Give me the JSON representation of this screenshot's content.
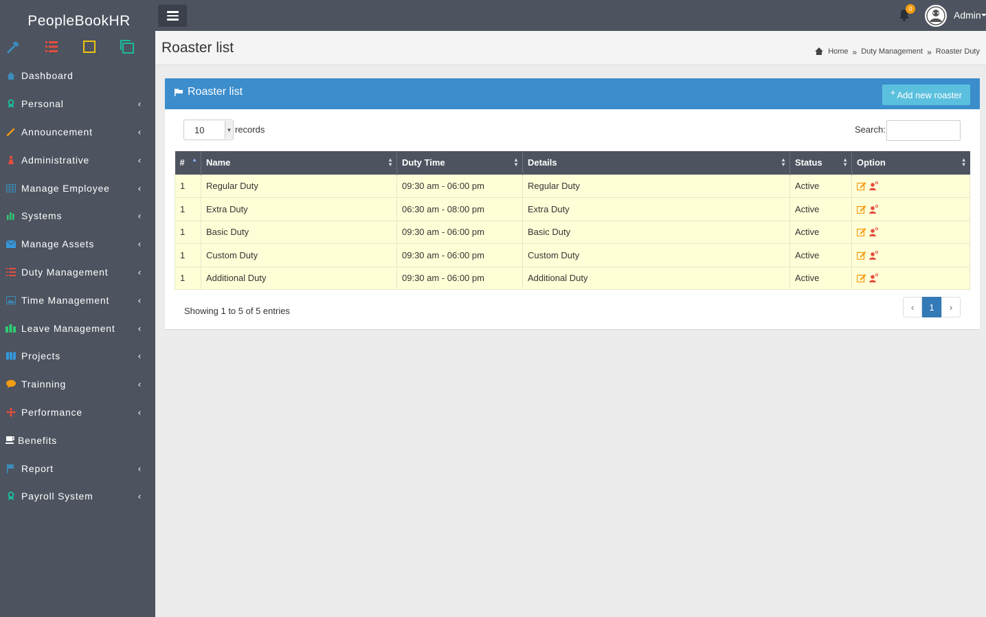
{
  "app": {
    "brand": "PeopleBookHR"
  },
  "sidebar": {
    "items": [
      {
        "label": "Dashboard",
        "icon": "home-icon",
        "color": "#3c8dbc",
        "has_children": false
      },
      {
        "label": "Personal",
        "icon": "award-icon",
        "color": "#1abc9c",
        "has_children": true
      },
      {
        "label": "Announcement",
        "icon": "pencil-icon",
        "color": "#f39c12",
        "has_children": true
      },
      {
        "label": "Administrative",
        "icon": "user-icon",
        "color": "#e74c3c",
        "has_children": true
      },
      {
        "label": "Manage Employee",
        "icon": "table-icon",
        "color": "#3c8dbc",
        "has_children": true
      },
      {
        "label": "Systems",
        "icon": "bar-chart-icon",
        "color": "#2ecc71",
        "has_children": true
      },
      {
        "label": "Manage Assets",
        "icon": "envelope-icon",
        "color": "#3498db",
        "has_children": true
      },
      {
        "label": "Duty Management",
        "icon": "list-icon",
        "color": "#e74c3c",
        "has_children": true
      },
      {
        "label": "Time Management",
        "icon": "picture-icon",
        "color": "#3c8dbc",
        "has_children": true
      },
      {
        "label": "Leave Management",
        "icon": "users-icon",
        "color": "#2ecc71",
        "has_children": true
      },
      {
        "label": "Projects",
        "icon": "map-icon",
        "color": "#3498db",
        "has_children": true
      },
      {
        "label": "Trainning",
        "icon": "comment-icon",
        "color": "#f39c12",
        "has_children": true
      },
      {
        "label": "Performance",
        "icon": "arrows-icon",
        "color": "#e74c3c",
        "has_children": true
      },
      {
        "label": "Benefits",
        "icon": "coffee-icon",
        "color": "#ffffff",
        "has_children": false
      },
      {
        "label": "Report",
        "icon": "flag-icon",
        "color": "#3c8dbc",
        "has_children": true
      },
      {
        "label": "Payroll System",
        "icon": "award-icon",
        "color": "#1abc9c",
        "has_children": true
      }
    ]
  },
  "topbar": {
    "notification_count": "0",
    "user_name": "Admin"
  },
  "header": {
    "title": "Roaster list",
    "breadcrumb": [
      "Home",
      "Duty Management",
      "Roaster Duty"
    ]
  },
  "panel": {
    "title": "Roaster list",
    "add_button": "Add new roaster",
    "page_length": "10",
    "records_label": "records",
    "search_label": "Search:",
    "search_value": "",
    "columns": [
      "#",
      "Name",
      "Duty Time",
      "Details",
      "Status",
      "Option"
    ],
    "rows": [
      {
        "num": "1",
        "name": "Regular Duty",
        "time": "09:30 am - 06:00 pm",
        "details": "Regular Duty",
        "status": "Active"
      },
      {
        "num": "1",
        "name": "Extra Duty",
        "time": "06:30 am - 08:00 pm",
        "details": "Extra Duty",
        "status": "Active"
      },
      {
        "num": "1",
        "name": "Basic Duty",
        "time": "09:30 am - 06:00 pm",
        "details": "Basic Duty",
        "status": "Active"
      },
      {
        "num": "1",
        "name": "Custom Duty",
        "time": "09:30 am - 06:00 pm",
        "details": "Custom Duty",
        "status": "Active"
      },
      {
        "num": "1",
        "name": "Additional Duty",
        "time": "09:30 am - 06:00 pm",
        "details": "Additional Duty",
        "status": "Active"
      }
    ],
    "info": "Showing 1 to 5 of 5 entries",
    "pagination": {
      "prev": "‹",
      "current": "1",
      "next": "›"
    }
  },
  "colors": {
    "sidebar_bg": "#4d535f",
    "panel_header": "#3c8dcc",
    "add_button": "#5bc0de",
    "row_bg": "#ffffd7",
    "edit_icon": "#f39c12",
    "user_icon": "#e74c3c"
  }
}
